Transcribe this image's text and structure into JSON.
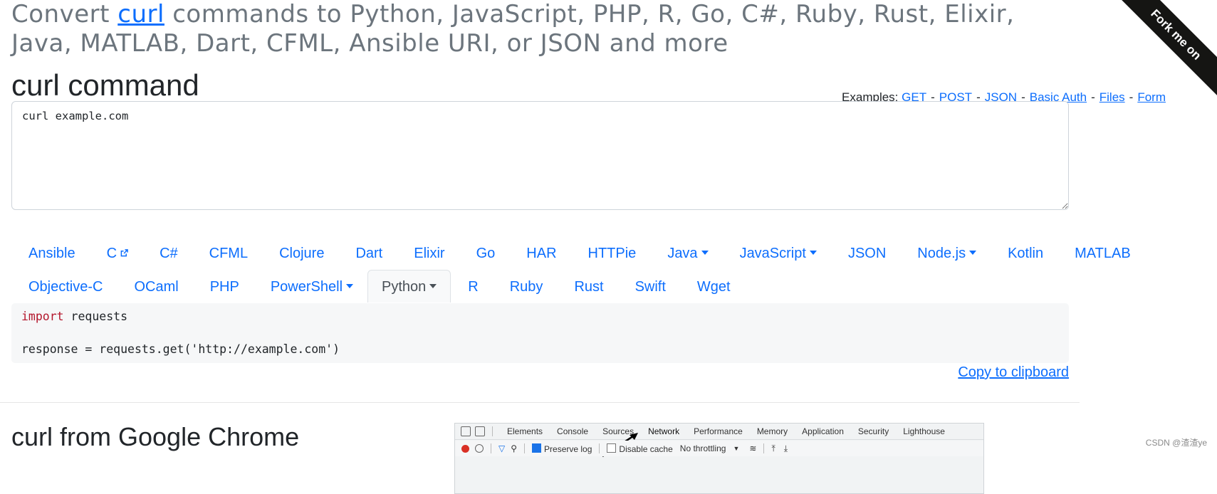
{
  "hero": {
    "prefix": "Convert ",
    "link": "curl",
    "suffix": " commands to Python, JavaScript, PHP, R, Go, C#, Ruby, Rust, Elixir, Java, MATLAB, Dart, CFML, Ansible URI, or JSON and more"
  },
  "ribbon": "Fork me on",
  "curl_section": {
    "heading": "curl command",
    "examples_label": "Examples:",
    "examples": [
      "GET",
      "POST",
      "JSON",
      "Basic Auth",
      "Files",
      "Form"
    ],
    "input_value": "curl example.com"
  },
  "language_tabs": {
    "row1": [
      {
        "label": "Ansible",
        "dropdown": false
      },
      {
        "label": "C",
        "external": true
      },
      {
        "label": "C#"
      },
      {
        "label": "CFML"
      },
      {
        "label": "Clojure"
      },
      {
        "label": "Dart"
      },
      {
        "label": "Elixir"
      },
      {
        "label": "Go"
      },
      {
        "label": "HAR"
      },
      {
        "label": "HTTPie"
      },
      {
        "label": "Java",
        "dropdown": true
      },
      {
        "label": "JavaScript",
        "dropdown": true
      },
      {
        "label": "JSON"
      },
      {
        "label": "Node.js",
        "dropdown": true
      },
      {
        "label": "Kotlin"
      },
      {
        "label": "MATLAB"
      }
    ],
    "row2": [
      {
        "label": "Objective-C"
      },
      {
        "label": "OCaml"
      },
      {
        "label": "PHP"
      },
      {
        "label": "PowerShell",
        "dropdown": true
      },
      {
        "label": "Python",
        "dropdown": true,
        "active": true
      },
      {
        "label": "R"
      },
      {
        "label": "Ruby"
      },
      {
        "label": "Rust"
      },
      {
        "label": "Swift"
      },
      {
        "label": "Wget"
      }
    ]
  },
  "output_code": {
    "line1_keyword": "import",
    "line1_rest": " requests",
    "line2": "",
    "line3": "response = requests.get('http://example.com')"
  },
  "copy_link": "Copy to clipboard",
  "chrome_section": {
    "heading": "curl from Google Chrome"
  },
  "devtools": {
    "tabs": [
      "Elements",
      "Console",
      "Sources",
      "Network",
      "Performance",
      "Memory",
      "Application",
      "Security",
      "Lighthouse"
    ],
    "active_tab": "Network",
    "preserve_log": "Preserve log",
    "disable_cache": "Disable cache",
    "throttling": "No throttling"
  },
  "watermark": "CSDN @渣渣ye",
  "colors": {
    "link": "#0d6efd",
    "keyword": "#b3162c",
    "muted": "#6c757d"
  }
}
